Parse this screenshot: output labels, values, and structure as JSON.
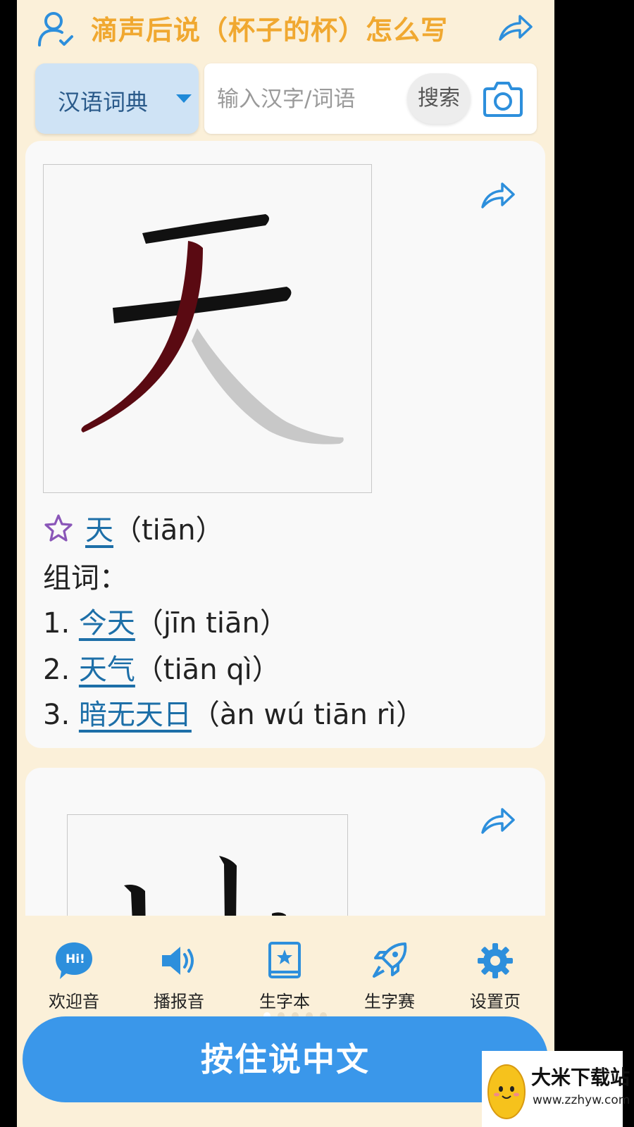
{
  "header": {
    "title": "滴声后说（杯子的杯）怎么写"
  },
  "search": {
    "dictionary": "汉语词典",
    "placeholder": "输入汉字/词语",
    "button": "搜索"
  },
  "cards": [
    {
      "character": "天",
      "pinyin": "（tiān）",
      "words_label": "组词：",
      "words": [
        {
          "index": "1.",
          "word": "今天",
          "pinyin": "（jīn tiān）"
        },
        {
          "index": "2.",
          "word": "天气",
          "pinyin": "（tiān qì）"
        },
        {
          "index": "3.",
          "word": "暗无天日",
          "pinyin": "（àn wú tiān rì）"
        }
      ]
    },
    {
      "character": "山"
    }
  ],
  "nav": [
    {
      "label": "欢迎音",
      "icon": "hi-chat-icon"
    },
    {
      "label": "播报音",
      "icon": "speaker-icon"
    },
    {
      "label": "生字本",
      "icon": "star-book-icon"
    },
    {
      "label": "生字赛",
      "icon": "rocket-icon"
    },
    {
      "label": "设置页",
      "icon": "gear-icon"
    }
  ],
  "pager": {
    "count": 5,
    "active": 1
  },
  "speak_button": "按住说中文",
  "watermark": {
    "name": "大米下载站",
    "url": "www.zzhyw.com"
  },
  "colors": {
    "title": "#f0a830",
    "accent_blue": "#1f8ad8",
    "button_blue": "#3a97ea",
    "link": "#1d6fa8",
    "background": "#fbf0d9"
  }
}
